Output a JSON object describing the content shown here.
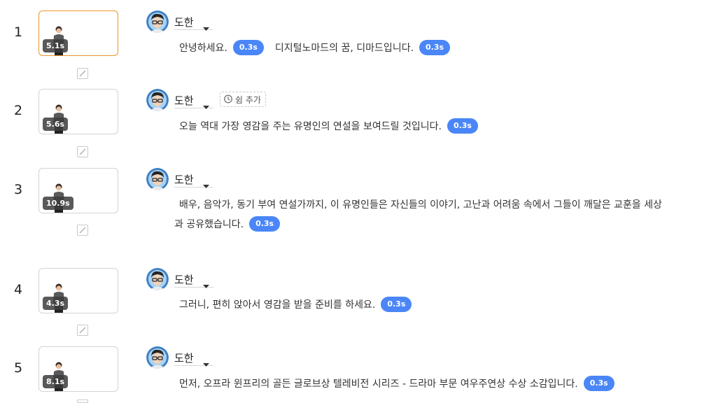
{
  "colors": {
    "accent_blue": "#4a86f7",
    "selected_border": "#e8962e"
  },
  "icons": {
    "transition": "transition-slash-icon",
    "speaker_caret": "chevron-down-icon",
    "pause": "timer-icon",
    "avatar": "speaker-avatar-icon"
  },
  "scenes": [
    {
      "number": "1",
      "duration": "5.1s",
      "selected": true,
      "speaker": "도한",
      "show_pause_button": false,
      "pause_label": "",
      "segments": [
        {
          "text": "안녕하세요.",
          "pause": "0.3s"
        },
        {
          "text": "디지털노마드의 꿈, 디마드입니다.",
          "pause": "0.3s"
        }
      ]
    },
    {
      "number": "2",
      "duration": "5.6s",
      "selected": false,
      "speaker": "도한",
      "show_pause_button": true,
      "pause_label": "쉼 추가",
      "segments": [
        {
          "text": "오늘 역대 가장 영감을 주는 유명인의 연설을 보여드릴 것입니다.",
          "pause": "0.3s"
        }
      ]
    },
    {
      "number": "3",
      "duration": "10.9s",
      "selected": false,
      "speaker": "도한",
      "show_pause_button": false,
      "pause_label": "",
      "segments": [
        {
          "text": "배우, 음악가, 동기 부여 연설가까지, 이 유명인들은 자신들의 이야기, 고난과 어려움 속에서 그들이 깨달은 교훈을 세상과 공유했습니다.",
          "pause": "0.3s"
        }
      ]
    },
    {
      "number": "4",
      "duration": "4.3s",
      "selected": false,
      "speaker": "도한",
      "show_pause_button": false,
      "pause_label": "",
      "segments": [
        {
          "text": "그러니, 편히 앉아서 영감을 받을 준비를 하세요.",
          "pause": "0.3s"
        }
      ]
    },
    {
      "number": "5",
      "duration": "8.1s",
      "selected": false,
      "speaker": "도한",
      "show_pause_button": false,
      "pause_label": "",
      "segments": [
        {
          "text": "먼저, 오프라 윈프리의 골든 글로브상 텔레비전 시리즈 - 드라마 부문 여우주연상 수상 소감입니다.",
          "pause": "0.3s"
        }
      ]
    }
  ]
}
